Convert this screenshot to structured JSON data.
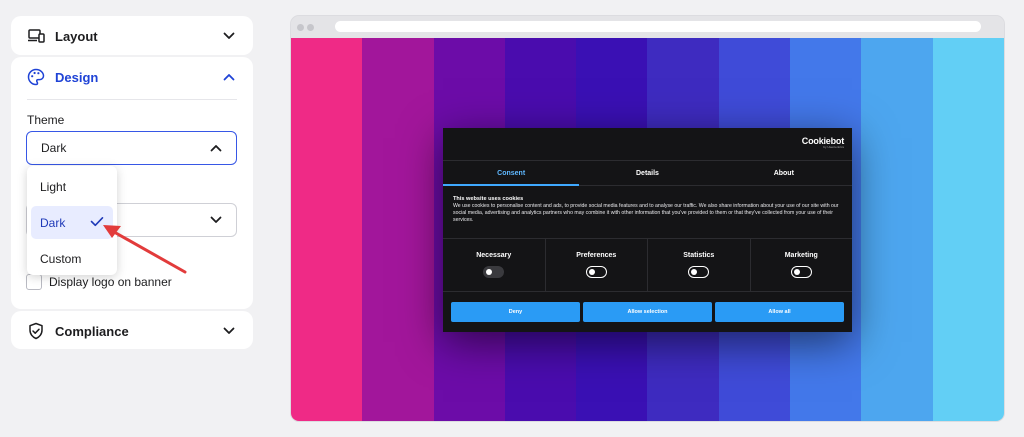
{
  "panel": {
    "layout": {
      "title": "Layout",
      "icon": "devices-icon"
    },
    "design": {
      "title": "Design",
      "icon": "palette-icon",
      "theme_label": "Theme",
      "theme_value": "Dark",
      "theme_options": [
        {
          "label": "Light",
          "selected": false
        },
        {
          "label": "Dark",
          "selected": true
        },
        {
          "label": "Custom",
          "selected": false
        }
      ],
      "logo_checkbox_label": "Display logo on banner",
      "logo_checkbox_checked": false
    },
    "compliance": {
      "title": "Compliance",
      "icon": "shield-check-icon"
    }
  },
  "preview": {
    "stripe_colors": [
      "#ef2a86",
      "#a2169b",
      "#6c0ca8",
      "#4a0cae",
      "#3a10b4",
      "#3e2bc0",
      "#3f4bd8",
      "#4378ea",
      "#4da6ef",
      "#62cff5"
    ],
    "banner": {
      "brand_name": "Cookiebot",
      "brand_sub": "by Usercentrics",
      "tabs": [
        {
          "label": "Consent",
          "active": true
        },
        {
          "label": "Details",
          "active": false
        },
        {
          "label": "About",
          "active": false
        }
      ],
      "heading": "This website uses cookies",
      "body": "We use cookies to personalise content and ads, to provide social media features and to analyse our traffic. We also share information about your use of our site with our social media, advertising and analytics partners who may combine it with other information that you've provided to them or that they've collected from your use of their services.",
      "categories": [
        {
          "label": "Necessary",
          "disabled": true
        },
        {
          "label": "Preferences",
          "disabled": false
        },
        {
          "label": "Statistics",
          "disabled": false
        },
        {
          "label": "Marketing",
          "disabled": false
        }
      ],
      "buttons": [
        "Deny",
        "Allow selection",
        "Allow all"
      ]
    }
  },
  "colors": {
    "accent": "#1f43d6",
    "banner_button": "#2a9bf5",
    "annotation_arrow": "#e23b3b"
  }
}
